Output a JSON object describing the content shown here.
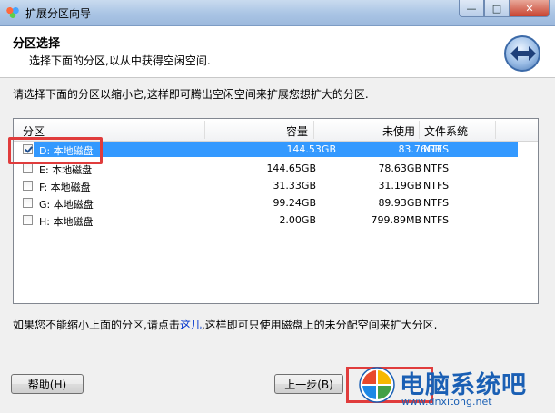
{
  "window": {
    "title": "扩展分区向导",
    "controls": [
      "minimize",
      "maximize",
      "close"
    ]
  },
  "header": {
    "title": "分区选择",
    "subtitle": "选择下面的分区,以从中获得空闲空间."
  },
  "instruction": "请选择下面的分区以缩小它,这样即可腾出空闲空间来扩展您想扩大的分区.",
  "table": {
    "columns": [
      "分区",
      "容量",
      "未使用",
      "文件系统"
    ],
    "rows": [
      {
        "name": "D: 本地磁盘",
        "capacity": "144.53GB",
        "unused": "83.76GB",
        "fs": "NTFS",
        "checked": true,
        "selected": true
      },
      {
        "name": "E: 本地磁盘",
        "capacity": "144.65GB",
        "unused": "78.63GB",
        "fs": "NTFS",
        "checked": false,
        "selected": false
      },
      {
        "name": "F: 本地磁盘",
        "capacity": "31.33GB",
        "unused": "31.19GB",
        "fs": "NTFS",
        "checked": false,
        "selected": false
      },
      {
        "name": "G: 本地磁盘",
        "capacity": "99.24GB",
        "unused": "89.93GB",
        "fs": "NTFS",
        "checked": false,
        "selected": false
      },
      {
        "name": "H: 本地磁盘",
        "capacity": "2.00GB",
        "unused": "799.89MB",
        "fs": "NTFS",
        "checked": false,
        "selected": false
      }
    ]
  },
  "footnote": {
    "before": "如果您不能缩小上面的分区,请点击",
    "link": "这儿",
    "after": ",这样即可只使用磁盘上的未分配空间来扩大分区."
  },
  "buttons": {
    "help": "帮助(H)",
    "back": "上一步(B)"
  },
  "watermark": {
    "title": "电脑系统吧",
    "url": "www.dnxitong.net"
  },
  "colors": {
    "selection": "#3399ff",
    "highlight_box": "#e03c3c",
    "link": "#0033cc",
    "watermark": "#1a5fb4"
  }
}
